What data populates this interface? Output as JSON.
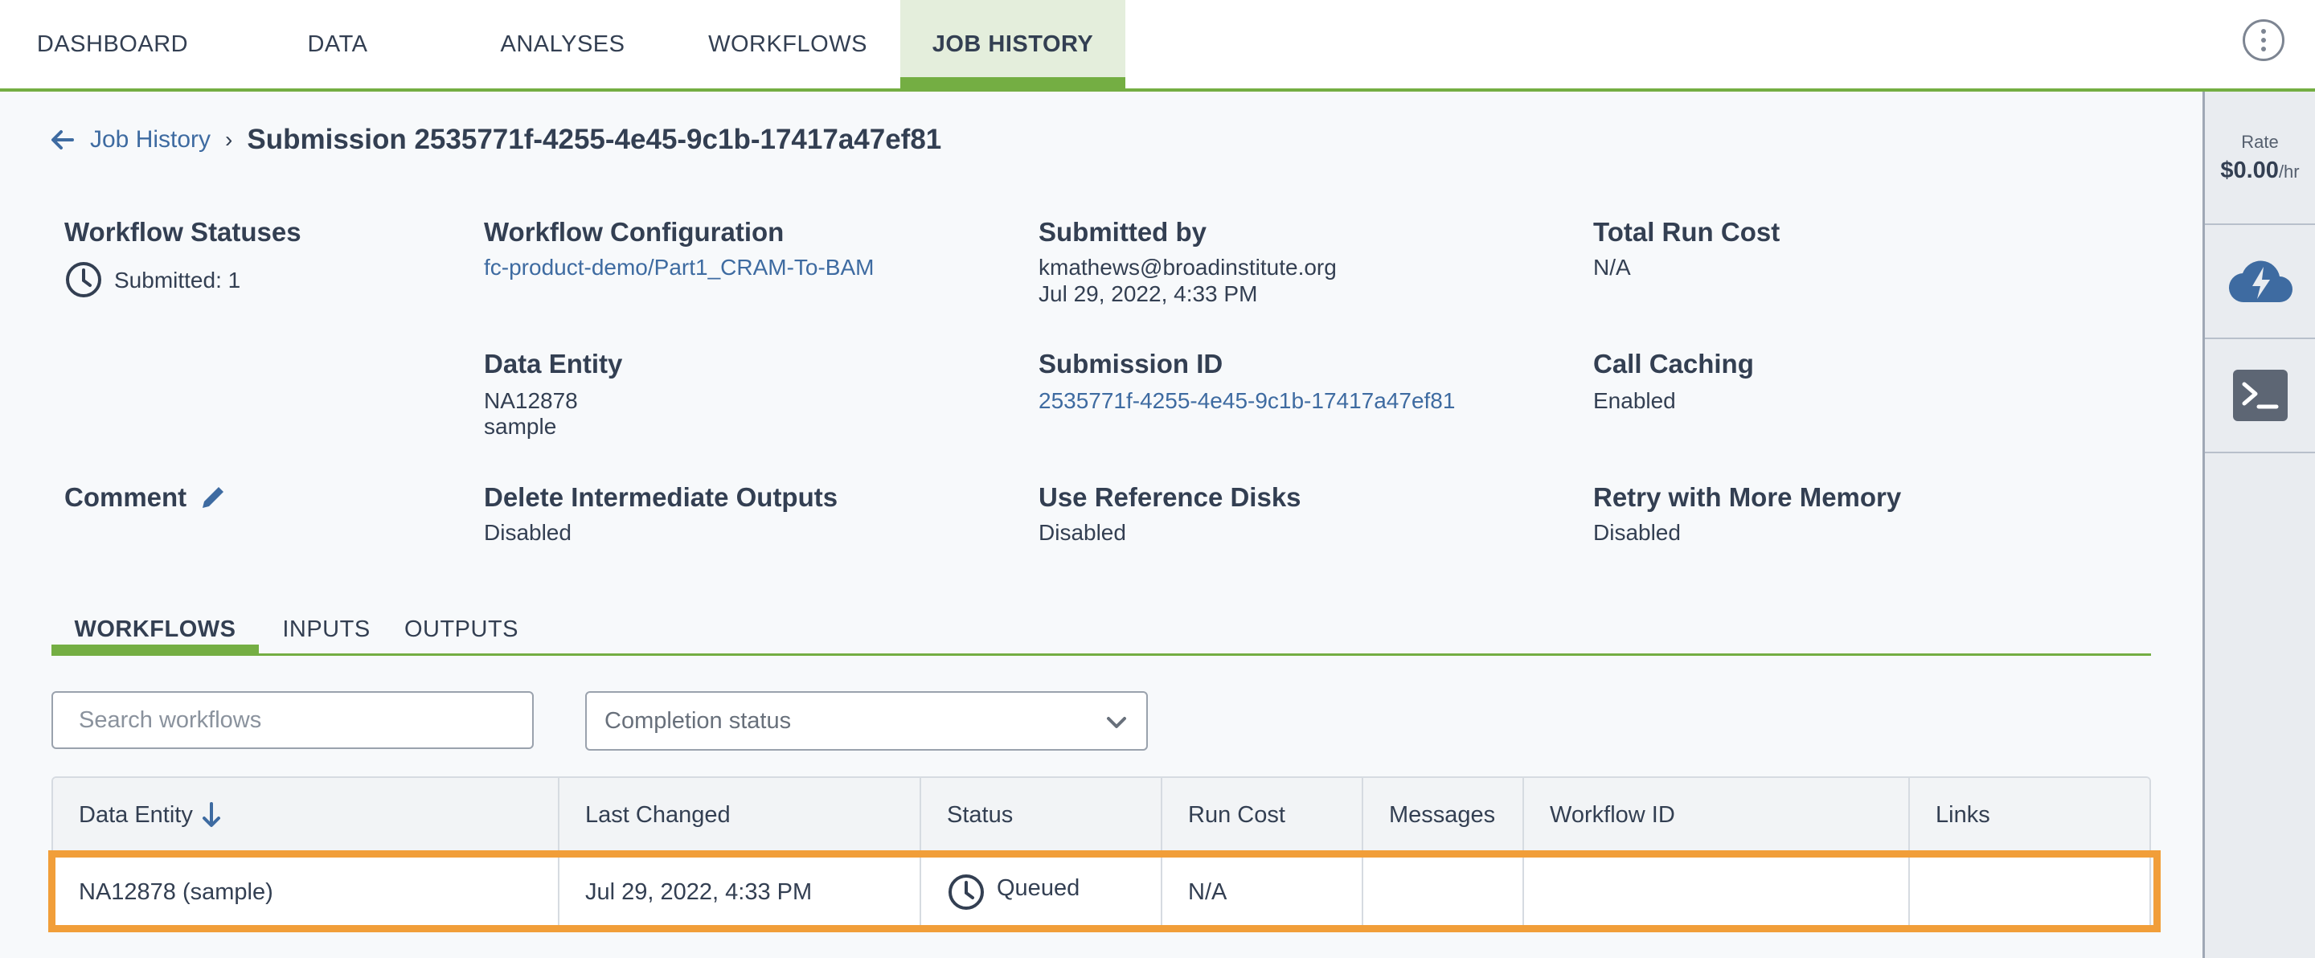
{
  "nav": {
    "tabs": [
      {
        "label": "DASHBOARD",
        "active": false
      },
      {
        "label": "DATA",
        "active": false
      },
      {
        "label": "ANALYSES",
        "active": false
      },
      {
        "label": "WORKFLOWS",
        "active": false
      },
      {
        "label": "JOB HISTORY",
        "active": true
      }
    ],
    "menu_icon": "more-vertical-icon"
  },
  "rail": {
    "rate_label": "Rate",
    "rate_value": "$0.00",
    "rate_unit": "/hr",
    "icons": [
      "cloud-environment-icon",
      "terminal-icon"
    ]
  },
  "breadcrumb": {
    "back_icon": "arrow-left-icon",
    "link_label": "Job History",
    "separator": "›",
    "title": "Submission 2535771f-4255-4e45-9c1b-17417a47ef81"
  },
  "details": {
    "workflow_statuses": {
      "label": "Workflow Statuses",
      "status": "Submitted: 1"
    },
    "workflow_configuration": {
      "label": "Workflow Configuration",
      "value": "fc-product-demo/Part1_CRAM-To-BAM"
    },
    "submitted_by": {
      "label": "Submitted by",
      "user": "kmathews@broadinstitute.org",
      "date": "Jul 29, 2022, 4:33 PM"
    },
    "total_run_cost": {
      "label": "Total Run Cost",
      "value": "N/A"
    },
    "data_entity": {
      "label": "Data Entity",
      "name": "NA12878",
      "type": "sample"
    },
    "submission_id": {
      "label": "Submission ID",
      "value": "2535771f-4255-4e45-9c1b-17417a47ef81"
    },
    "call_caching": {
      "label": "Call Caching",
      "value": "Enabled"
    },
    "comment": {
      "label": "Comment"
    },
    "delete_intermediate_outputs": {
      "label": "Delete Intermediate Outputs",
      "value": "Disabled"
    },
    "use_reference_disks": {
      "label": "Use Reference Disks",
      "value": "Disabled"
    },
    "retry_with_more_memory": {
      "label": "Retry with More Memory",
      "value": "Disabled"
    }
  },
  "subtabs": [
    {
      "label": "WORKFLOWS",
      "active": true
    },
    {
      "label": "INPUTS",
      "active": false
    },
    {
      "label": "OUTPUTS",
      "active": false
    }
  ],
  "filters": {
    "search_placeholder": "Search workflows",
    "completion_status": "Completion status"
  },
  "table": {
    "columns": [
      "Data Entity",
      "Last Changed",
      "Status",
      "Run Cost",
      "Messages",
      "Workflow ID",
      "Links"
    ],
    "sort_column": "Data Entity",
    "sort_icon": "arrow-down-icon",
    "rows": [
      {
        "data_entity": "NA12878 (sample)",
        "last_changed": "Jul 29, 2022, 4:33 PM",
        "status": "Queued",
        "run_cost": "N/A",
        "messages": "",
        "workflow_id": "",
        "links": ""
      }
    ]
  },
  "colors": {
    "accent_green": "#74ae43",
    "link_blue": "#3e6ba1",
    "highlight_orange": "#f19e39",
    "text_dark": "#333f52"
  }
}
